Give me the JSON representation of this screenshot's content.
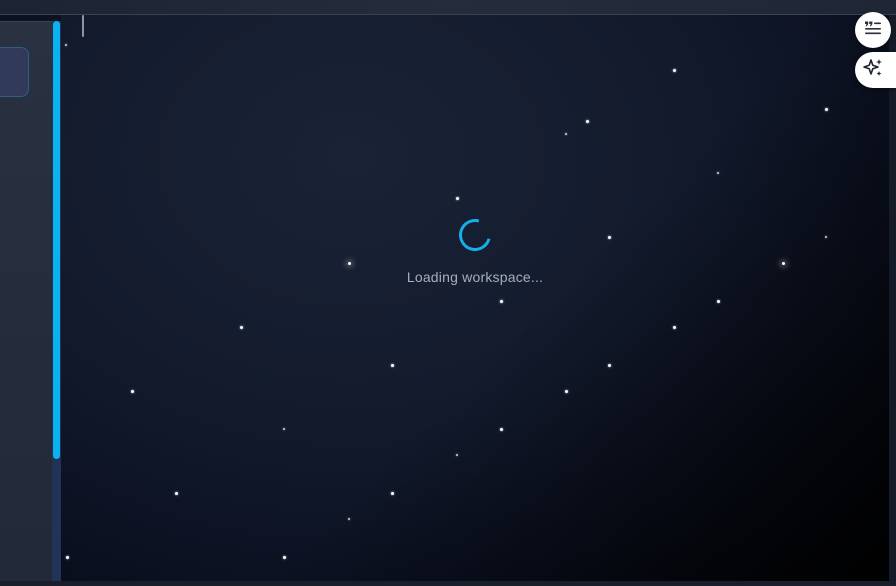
{
  "loading": {
    "message": "Loading workspace..."
  },
  "colors": {
    "accent": "#0ab3f0",
    "spinner": "#16aee9",
    "background": "#0d1220",
    "text_muted": "#a7afbd"
  },
  "icons": {
    "menu": "quote-list-icon",
    "ai": "sparkles-icon"
  }
}
